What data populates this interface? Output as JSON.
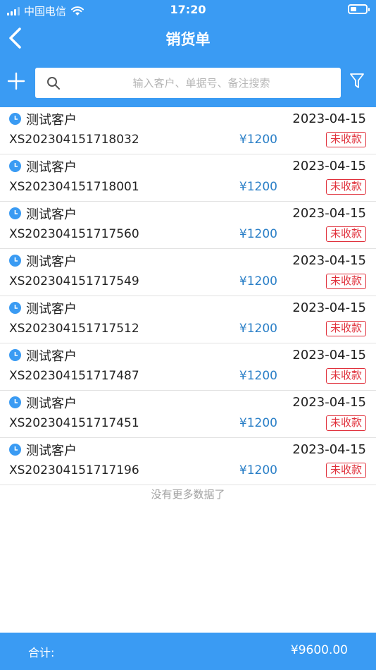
{
  "status_bar": {
    "carrier": "中国电信",
    "time": "17:20"
  },
  "nav": {
    "title": "销货单"
  },
  "search": {
    "placeholder": "输入客户、单据号、备注搜索"
  },
  "orders": [
    {
      "customer": "测试客户",
      "date": "2023-04-15",
      "order_no": "XS202304151718032",
      "amount": "¥1200",
      "status": "未收款"
    },
    {
      "customer": "测试客户",
      "date": "2023-04-15",
      "order_no": "XS202304151718001",
      "amount": "¥1200",
      "status": "未收款"
    },
    {
      "customer": "测试客户",
      "date": "2023-04-15",
      "order_no": "XS202304151717560",
      "amount": "¥1200",
      "status": "未收款"
    },
    {
      "customer": "测试客户",
      "date": "2023-04-15",
      "order_no": "XS202304151717549",
      "amount": "¥1200",
      "status": "未收款"
    },
    {
      "customer": "测试客户",
      "date": "2023-04-15",
      "order_no": "XS202304151717512",
      "amount": "¥1200",
      "status": "未收款"
    },
    {
      "customer": "测试客户",
      "date": "2023-04-15",
      "order_no": "XS202304151717487",
      "amount": "¥1200",
      "status": "未收款"
    },
    {
      "customer": "测试客户",
      "date": "2023-04-15",
      "order_no": "XS202304151717451",
      "amount": "¥1200",
      "status": "未收款"
    },
    {
      "customer": "测试客户",
      "date": "2023-04-15",
      "order_no": "XS202304151717196",
      "amount": "¥1200",
      "status": "未收款"
    }
  ],
  "list_end_text": "没有更多数据了",
  "footer": {
    "total_label": "合计:",
    "total_value": "¥9600.00"
  },
  "icons": [
    "back-arrow-icon",
    "add-icon",
    "search-icon",
    "filter-icon",
    "clock-icon",
    "wifi-icon",
    "battery-icon",
    "signal-icon"
  ],
  "colors": {
    "primary": "#3a9bf3",
    "amount": "#2a7fc7",
    "status": "#e0303b"
  }
}
